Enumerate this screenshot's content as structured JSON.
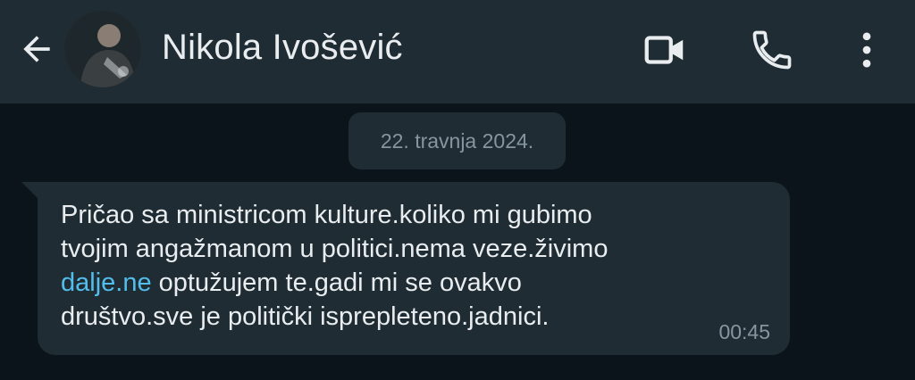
{
  "header": {
    "contact_name": "Nikola Ivošević",
    "back_icon": "arrow-left-icon",
    "video_icon": "video-camera-icon",
    "call_icon": "phone-icon",
    "menu_icon": "more-vert-icon"
  },
  "chat": {
    "date_label": "22. travnja 2024.",
    "message": {
      "line1": "Pričao sa ministricom kulture.koliko mi gubimo",
      "line2": "tvojim angažmanom u politici.nema veze.živimo",
      "link_text": "dalje.ne",
      "line3_rest": " optužujem te.gadi mi se ovakvo",
      "line4": "društvo.sve je politički isprepleteno.jadnici.",
      "time": "00:45"
    }
  },
  "colors": {
    "background": "#0b141a",
    "header": "#1f2c33",
    "bubble": "#1f2c33",
    "text": "#e9edef",
    "muted": "#8696a0",
    "link": "#53bdeb"
  }
}
